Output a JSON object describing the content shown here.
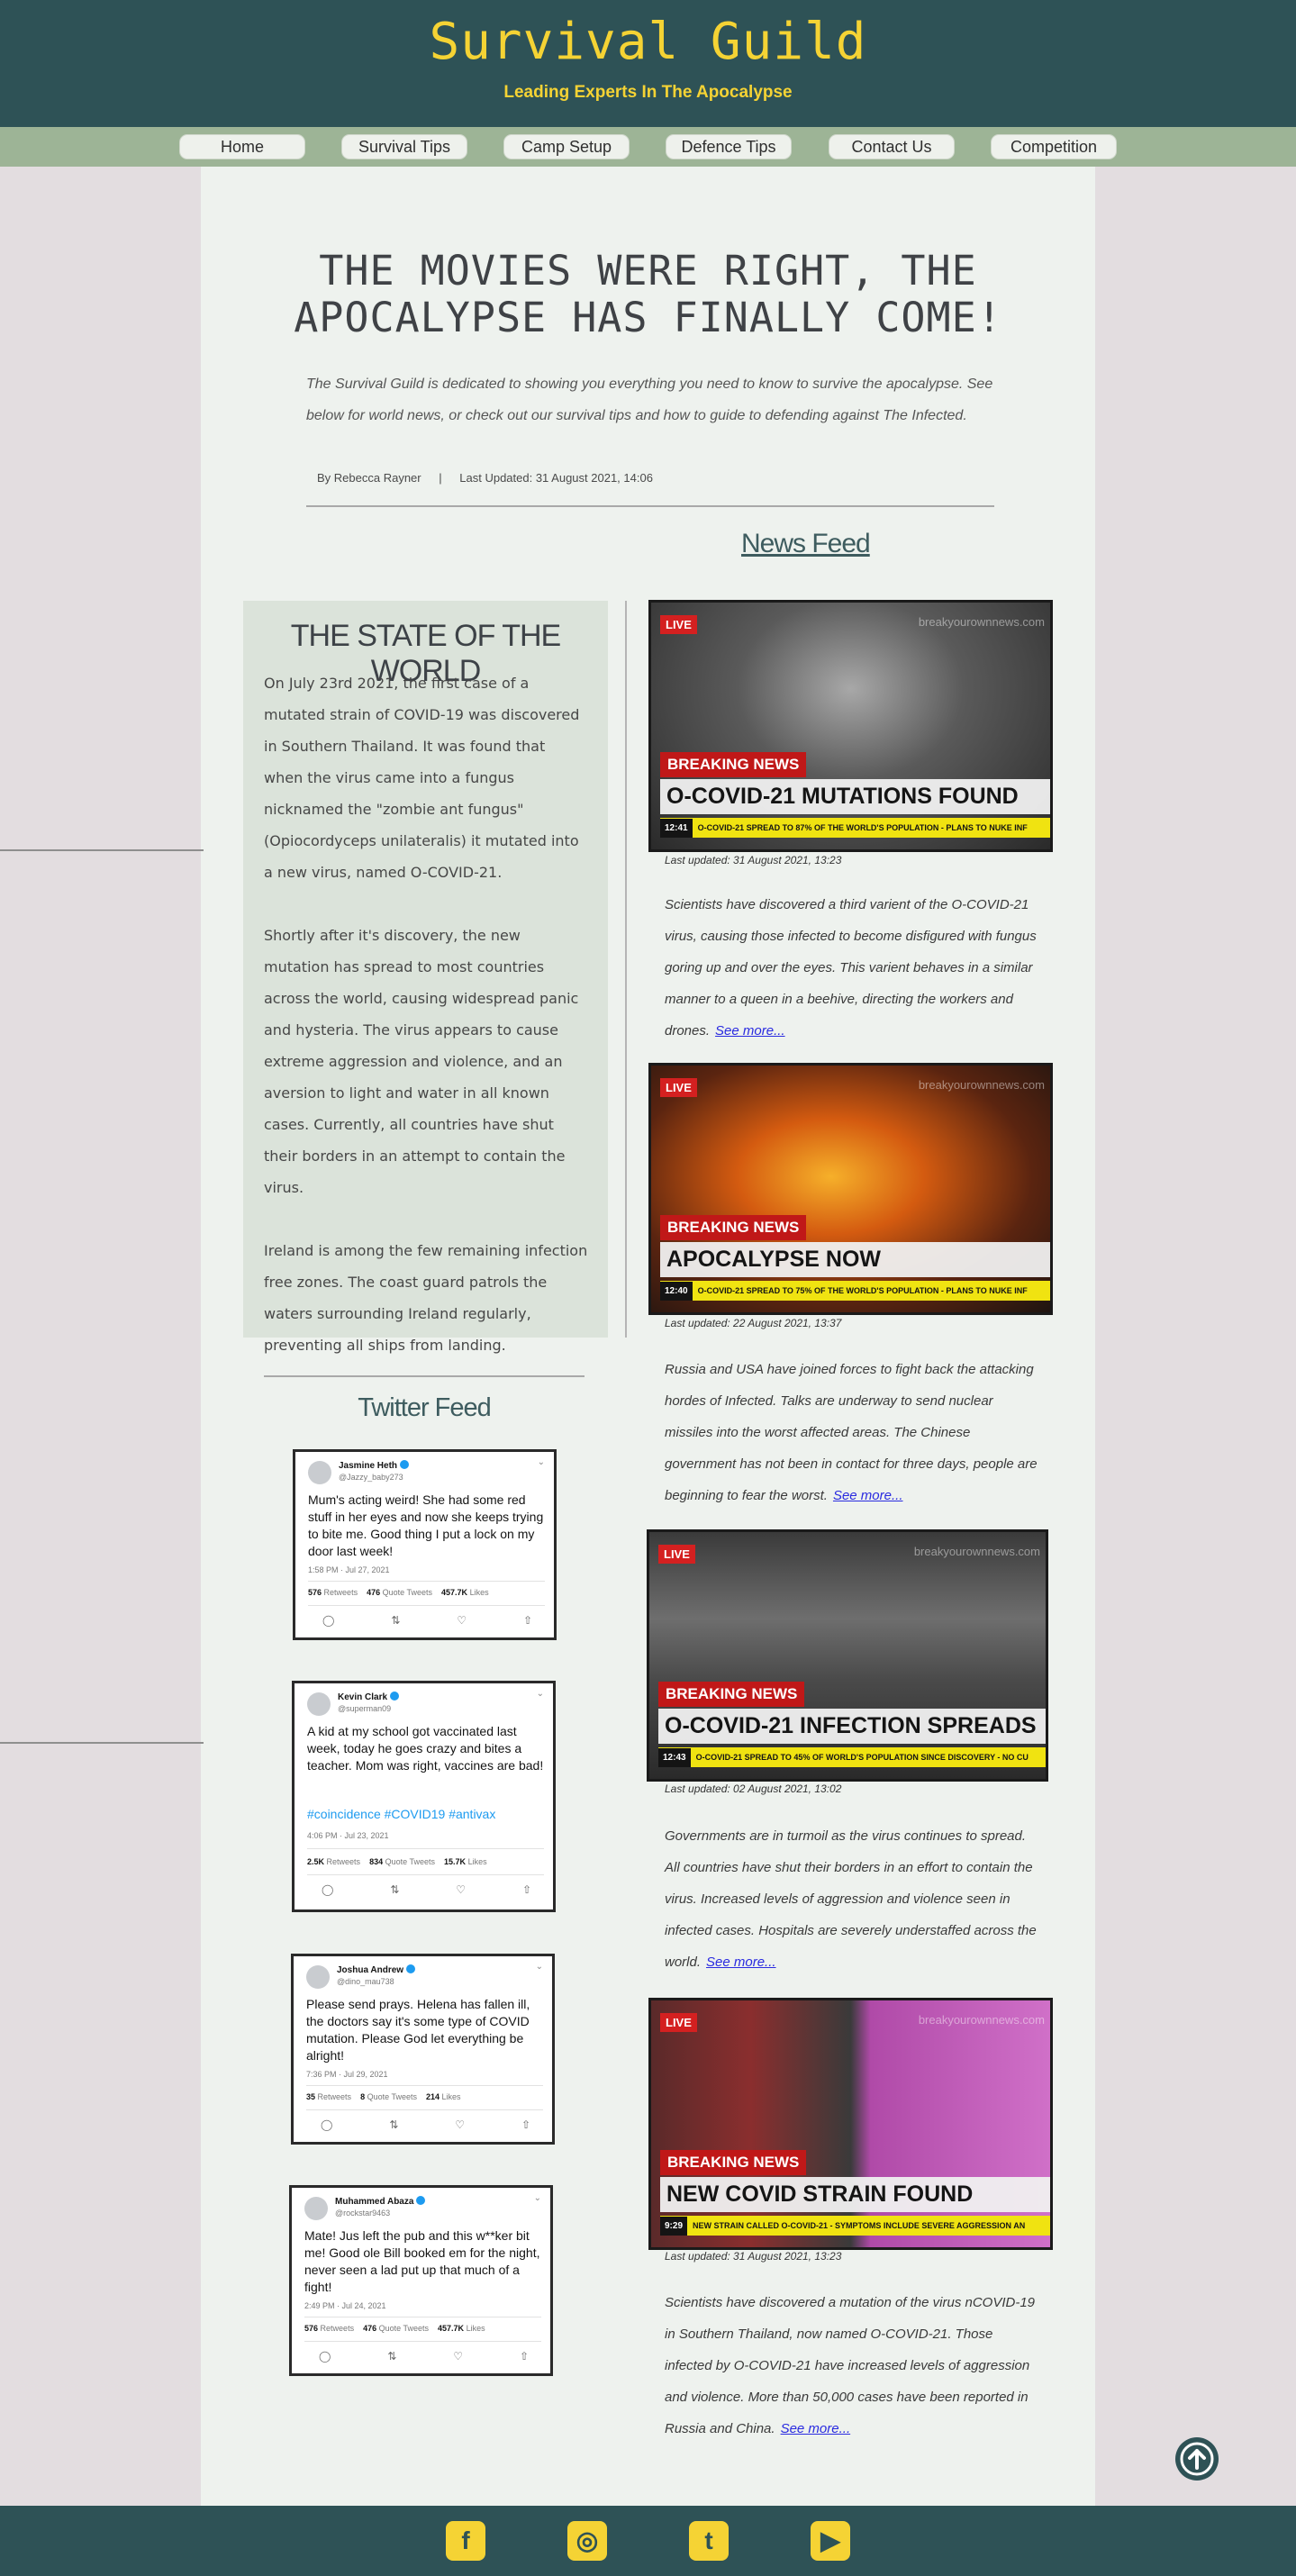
{
  "header": {
    "title": "Survival Guild",
    "tagline": "Leading Experts In The Apocalypse"
  },
  "nav": [
    "Home",
    "Survival Tips",
    "Camp Setup",
    "Defence Tips",
    "Contact Us",
    "Competition"
  ],
  "hero": {
    "title": "THE MOVIES WERE RIGHT, THE APOCALYPSE HAS FINALLY COME!",
    "intro": "The Survival Guild is dedicated to showing you everything you need to know to survive the apocalypse. See below for world news, or check out our survival tips and how to guide to defending against The Infected.",
    "author": "By Rebecca Rayner",
    "separator": "|",
    "updated": "Last Updated:  31 August 2021, 14:06"
  },
  "world": {
    "title": "THE STATE OF THE WORLD",
    "paragraphs": [
      "On July 23rd 2021, the first case of a mutated strain of COVID-19 was discovered in Southern Thailand.  It was found that when the virus came into a fungus nicknamed the \"zombie ant fungus\" (Opiocordyceps unilateralis) it mutated into a new virus, named O-COVID-21.",
      "Shortly after it's discovery, the new mutation has spread to most countries across the world, causing widespread panic and hysteria. The virus appears to cause extreme aggression and violence, and an aversion to light and water in all known cases. Currently, all countries have shut their borders  in an attempt to contain the virus.",
      "Ireland is among the few remaining infection free zones. The coast guard patrols the waters surrounding Ireland regularly, preventing all ships from landing."
    ]
  },
  "twitter": {
    "title": "Twitter Feed",
    "tweets": [
      {
        "name": "Jasmine Heth",
        "handle": "@Jazzy_baby273",
        "text": "Mum's acting weird! She had some red stuff in her eyes and now she keeps trying to bite me. Good thing I put a lock on my door last week!",
        "tags": "",
        "date": "1:58 PM · Jul 27, 2021",
        "retweets": "576",
        "quotes": "476",
        "likes": "457.7K"
      },
      {
        "name": "Kevin Clark",
        "handle": "@superman09",
        "text": "A kid at my school got vaccinated last week, today he goes crazy and bites a teacher. Mom was right, vaccines are bad!",
        "tags": "#coincidence #COVID19 #antivax",
        "date": "4:06 PM · Jul 23, 2021",
        "retweets": "2.5K",
        "quotes": "834",
        "likes": "15.7K"
      },
      {
        "name": "Joshua Andrew",
        "handle": "@dino_mau738",
        "text": "Please send prays. Helena has fallen ill, the doctors say it's some type of COVID mutation. Please God let everything be alright!",
        "tags": "",
        "date": "7:36 PM · Jul 29, 2021",
        "retweets": "35",
        "quotes": "8",
        "likes": "214"
      },
      {
        "name": "Muhammed Abaza",
        "handle": "@rockstar9463",
        "text": "Mate! Jus left the pub and this w**ker bit me! Good ole Bill booked em for the night, never seen a lad put up that much of a fight!",
        "tags": "",
        "date": "2:49 PM · Jul 24, 2021",
        "retweets": "576",
        "quotes": "476",
        "likes": "457.7K"
      }
    ],
    "labels": {
      "retweets": "Retweets",
      "quotes": "Quote Tweets",
      "likes": "Likes"
    }
  },
  "news": {
    "title": "News Feed",
    "live": "LIVE",
    "breaking": "BREAKING NEWS",
    "watermark": "breakyourownnews.com",
    "see_more": "See more...",
    "items": [
      {
        "headline": "O-COVID-21 MUTATIONS FOUND",
        "time": "12:41",
        "ticker": "O-COVID-21 SPREAD TO 87% OF THE WORLD'S POPULATION - PLANS TO NUKE INF",
        "updated": "Last updated:   31 August 2021, 13:23",
        "story": "Scientists have discovered a third varient of the O-COVID-21 virus, causing those infected to become disfigured with fungus goring up and over the eyes. This varient behaves in a similar manner to a queen in a beehive, directing the workers and drones."
      },
      {
        "headline": "APOCALYPSE NOW",
        "time": "12:40",
        "ticker": "O-COVID-21 SPREAD TO 75% OF THE WORLD'S POPULATION - PLANS TO NUKE INF",
        "updated": "Last updated:   22 August 2021, 13:37",
        "story": "Russia and USA have joined forces to fight back the attacking hordes of Infected. Talks are underway to send nuclear missiles into the worst affected areas. The Chinese government has not been in contact for three days, people are beginning to fear the worst."
      },
      {
        "headline": "O-COVID-21 INFECTION SPREADS",
        "time": "12:43",
        "ticker": "O-COVID-21 SPREAD TO 45% OF WORLD'S POPULATION SINCE DISCOVERY - NO CU",
        "updated": "Last updated:   02 August 2021, 13:02",
        "story": "Governments are in turmoil as the virus continues to spread. All countries have shut their borders in an effort to contain the virus. Increased levels of aggression and violence seen in infected cases. Hospitals are severely understaffed across the world."
      },
      {
        "headline": "NEW COVID STRAIN FOUND",
        "time": "9:29",
        "ticker": "NEW STRAIN CALLED O-COVID-21 - SYMPTOMS INCLUDE SEVERE AGGRESSION AN",
        "updated": "Last updated:   31 August 2021, 13:23",
        "story": "Scientists have discovered a mutation of the virus nCOVID-19 in Southern Thailand, now named O-COVID-21. Those infected by O-COVID-21 have increased levels of aggression and violence. More than 50,000 cases have been reported in Russia and China."
      }
    ]
  },
  "footer": {
    "social": [
      {
        "icon": "facebook-icon",
        "glyph": "f"
      },
      {
        "icon": "instagram-icon",
        "glyph": "◎"
      },
      {
        "icon": "twitter-icon",
        "glyph": "t"
      },
      {
        "icon": "youtube-icon",
        "glyph": "▶"
      }
    ]
  },
  "colors": {
    "primary": "#2e5256",
    "accent": "#f5d334",
    "nav": "#9db496",
    "panel": "#dbe3da",
    "breaking": "#c01818",
    "ticker": "#f0e311"
  }
}
